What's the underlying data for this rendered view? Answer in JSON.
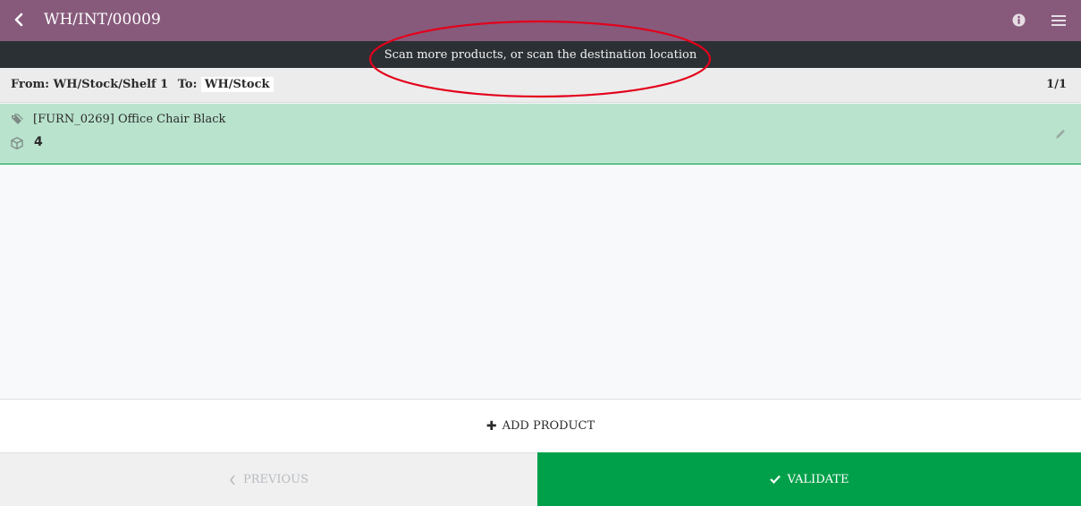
{
  "header": {
    "title": "WH/INT/00009",
    "back_icon": "chevron-left-icon",
    "info_icon": "info-circle-icon",
    "menu_icon": "hamburger-menu-icon"
  },
  "notice": {
    "message": "Scan more products, or scan the destination location"
  },
  "location_bar": {
    "from_label": "From:",
    "from_value": "WH/Stock/Shelf 1",
    "to_label": "To:",
    "to_value": "WH/Stock",
    "page_counter": "1/1"
  },
  "lines": [
    {
      "product": "[FURN_0269] Office Chair Black",
      "quantity": "4"
    }
  ],
  "actions": {
    "add_product_label": "Add product",
    "previous_label": "Previous",
    "validate_label": "Validate"
  },
  "colors": {
    "header": "#875a7b",
    "notice_bg": "#2b3034",
    "line_highlight": "#b9e3cd",
    "validate": "#00a04a",
    "annotation": "#e3001b"
  }
}
